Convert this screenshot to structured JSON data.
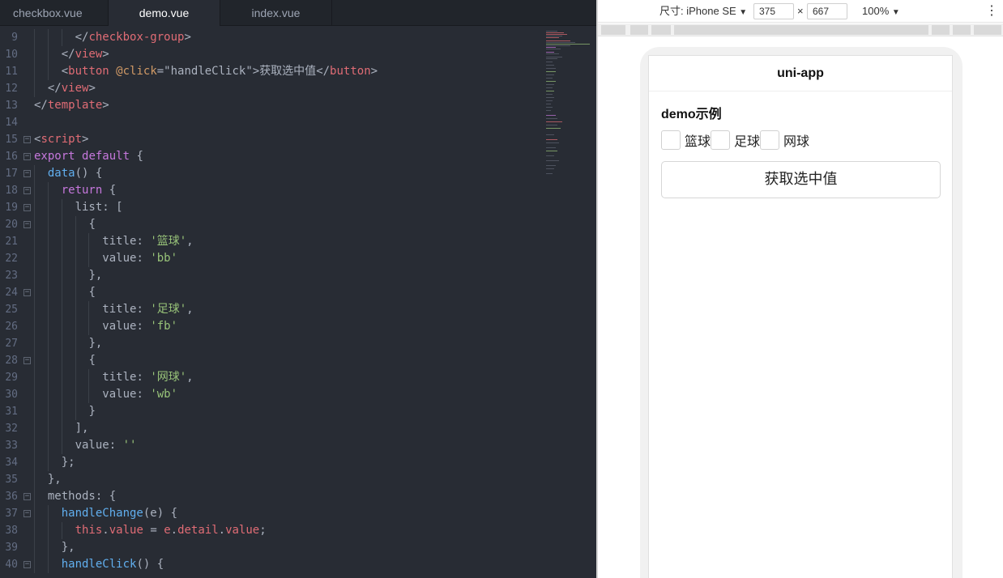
{
  "editor": {
    "tabs": [
      {
        "label": "checkbox.vue",
        "active": false
      },
      {
        "label": "demo.vue",
        "active": true
      },
      {
        "label": "index.vue",
        "active": false
      }
    ],
    "colors": {
      "background": "#282c34",
      "tag": "#e06c75",
      "keyword": "#c678dd",
      "function": "#61afef",
      "string": "#98c379",
      "attribute": "#d19a66"
    },
    "lines": [
      {
        "n": "9",
        "fold": "",
        "indent": 3,
        "tokens": [
          [
            "pun",
            "</"
          ],
          [
            "tag",
            "checkbox-group"
          ],
          [
            "pun",
            ">"
          ]
        ]
      },
      {
        "n": "10",
        "fold": "",
        "indent": 2,
        "tokens": [
          [
            "pun",
            "</"
          ],
          [
            "tag",
            "view"
          ],
          [
            "pun",
            ">"
          ]
        ]
      },
      {
        "n": "11",
        "fold": "",
        "indent": 2,
        "tokens": [
          [
            "pun",
            "<"
          ],
          [
            "tag",
            "button"
          ],
          [
            "txt",
            " "
          ],
          [
            "attr",
            "@click"
          ],
          [
            "pun",
            "=\""
          ],
          [
            "txt",
            "handleClick"
          ],
          [
            "pun",
            "\">"
          ],
          [
            "txt",
            "获取选中值"
          ],
          [
            "pun",
            "</"
          ],
          [
            "tag",
            "button"
          ],
          [
            "pun",
            ">"
          ]
        ]
      },
      {
        "n": "12",
        "fold": "",
        "indent": 1,
        "tokens": [
          [
            "pun",
            "</"
          ],
          [
            "tag",
            "view"
          ],
          [
            "pun",
            ">"
          ]
        ]
      },
      {
        "n": "13",
        "fold": "",
        "indent": 0,
        "tokens": [
          [
            "pun",
            "</"
          ],
          [
            "tag",
            "template"
          ],
          [
            "pun",
            ">"
          ]
        ]
      },
      {
        "n": "14",
        "fold": "",
        "indent": 0,
        "tokens": []
      },
      {
        "n": "15",
        "fold": "⊟",
        "indent": 0,
        "tokens": [
          [
            "pun",
            "<"
          ],
          [
            "tag",
            "script"
          ],
          [
            "pun",
            ">"
          ]
        ]
      },
      {
        "n": "16",
        "fold": "⊟",
        "indent": 0,
        "tokens": [
          [
            "kw",
            "export"
          ],
          [
            "txt",
            " "
          ],
          [
            "kw",
            "default"
          ],
          [
            "txt",
            " {"
          ]
        ]
      },
      {
        "n": "17",
        "fold": "⊟",
        "indent": 1,
        "tokens": [
          [
            "fn",
            "data"
          ],
          [
            "txt",
            "() {"
          ]
        ]
      },
      {
        "n": "18",
        "fold": "⊟",
        "indent": 2,
        "tokens": [
          [
            "kw",
            "return"
          ],
          [
            "txt",
            " {"
          ]
        ]
      },
      {
        "n": "19",
        "fold": "⊟",
        "indent": 3,
        "tokens": [
          [
            "txt",
            "list: ["
          ]
        ]
      },
      {
        "n": "20",
        "fold": "⊟",
        "indent": 4,
        "tokens": [
          [
            "txt",
            "{"
          ]
        ]
      },
      {
        "n": "21",
        "fold": "",
        "indent": 5,
        "tokens": [
          [
            "txt",
            "title: "
          ],
          [
            "str",
            "'篮球'"
          ],
          [
            "txt",
            ","
          ]
        ]
      },
      {
        "n": "22",
        "fold": "",
        "indent": 5,
        "tokens": [
          [
            "txt",
            "value: "
          ],
          [
            "str",
            "'bb'"
          ]
        ]
      },
      {
        "n": "23",
        "fold": "",
        "indent": 4,
        "tokens": [
          [
            "txt",
            "},"
          ]
        ]
      },
      {
        "n": "24",
        "fold": "⊟",
        "indent": 4,
        "tokens": [
          [
            "txt",
            "{"
          ]
        ]
      },
      {
        "n": "25",
        "fold": "",
        "indent": 5,
        "tokens": [
          [
            "txt",
            "title: "
          ],
          [
            "str",
            "'足球'"
          ],
          [
            "txt",
            ","
          ]
        ]
      },
      {
        "n": "26",
        "fold": "",
        "indent": 5,
        "tokens": [
          [
            "txt",
            "value: "
          ],
          [
            "str",
            "'fb'"
          ]
        ]
      },
      {
        "n": "27",
        "fold": "",
        "indent": 4,
        "tokens": [
          [
            "txt",
            "},"
          ]
        ]
      },
      {
        "n": "28",
        "fold": "⊟",
        "indent": 4,
        "tokens": [
          [
            "txt",
            "{"
          ]
        ]
      },
      {
        "n": "29",
        "fold": "",
        "indent": 5,
        "tokens": [
          [
            "txt",
            "title: "
          ],
          [
            "str",
            "'网球'"
          ],
          [
            "txt",
            ","
          ]
        ]
      },
      {
        "n": "30",
        "fold": "",
        "indent": 5,
        "tokens": [
          [
            "txt",
            "value: "
          ],
          [
            "str",
            "'wb'"
          ]
        ]
      },
      {
        "n": "31",
        "fold": "",
        "indent": 4,
        "tokens": [
          [
            "txt",
            "}"
          ]
        ]
      },
      {
        "n": "32",
        "fold": "",
        "indent": 3,
        "tokens": [
          [
            "txt",
            "],"
          ]
        ]
      },
      {
        "n": "33",
        "fold": "",
        "indent": 3,
        "tokens": [
          [
            "txt",
            "value: "
          ],
          [
            "str",
            "''"
          ]
        ]
      },
      {
        "n": "34",
        "fold": "",
        "indent": 2,
        "tokens": [
          [
            "txt",
            "};"
          ]
        ]
      },
      {
        "n": "35",
        "fold": "",
        "indent": 1,
        "tokens": [
          [
            "txt",
            "},"
          ]
        ]
      },
      {
        "n": "36",
        "fold": "⊟",
        "indent": 1,
        "tokens": [
          [
            "txt",
            "methods: {"
          ]
        ]
      },
      {
        "n": "37",
        "fold": "⊟",
        "indent": 2,
        "tokens": [
          [
            "fn",
            "handleChange"
          ],
          [
            "txt",
            "(e) {"
          ]
        ]
      },
      {
        "n": "38",
        "fold": "",
        "indent": 3,
        "tokens": [
          [
            "prop",
            "this"
          ],
          [
            "txt",
            "."
          ],
          [
            "prop",
            "value"
          ],
          [
            "txt",
            " = "
          ],
          [
            "prop",
            "e"
          ],
          [
            "txt",
            "."
          ],
          [
            "prop",
            "detail"
          ],
          [
            "txt",
            "."
          ],
          [
            "prop",
            "value"
          ],
          [
            "txt",
            ";"
          ]
        ]
      },
      {
        "n": "39",
        "fold": "",
        "indent": 2,
        "tokens": [
          [
            "txt",
            "},"
          ]
        ]
      },
      {
        "n": "40",
        "fold": "⊟",
        "indent": 2,
        "tokens": [
          [
            "fn",
            "handleClick"
          ],
          [
            "txt",
            "() {"
          ]
        ]
      }
    ]
  },
  "devtool": {
    "size_label": "尺寸: iPhone SE",
    "dropdown_caret": "▼",
    "width_value": "375",
    "times_sign": "×",
    "height_value": "667",
    "zoom_label": "100%",
    "more_icon": "⋮"
  },
  "app": {
    "nav_title": "uni-app",
    "section_title": "demo示例",
    "checkboxes": [
      {
        "label": "篮球",
        "checked": false
      },
      {
        "label": "足球",
        "checked": false
      },
      {
        "label": "网球",
        "checked": false
      }
    ],
    "button_label": "获取选中值"
  }
}
